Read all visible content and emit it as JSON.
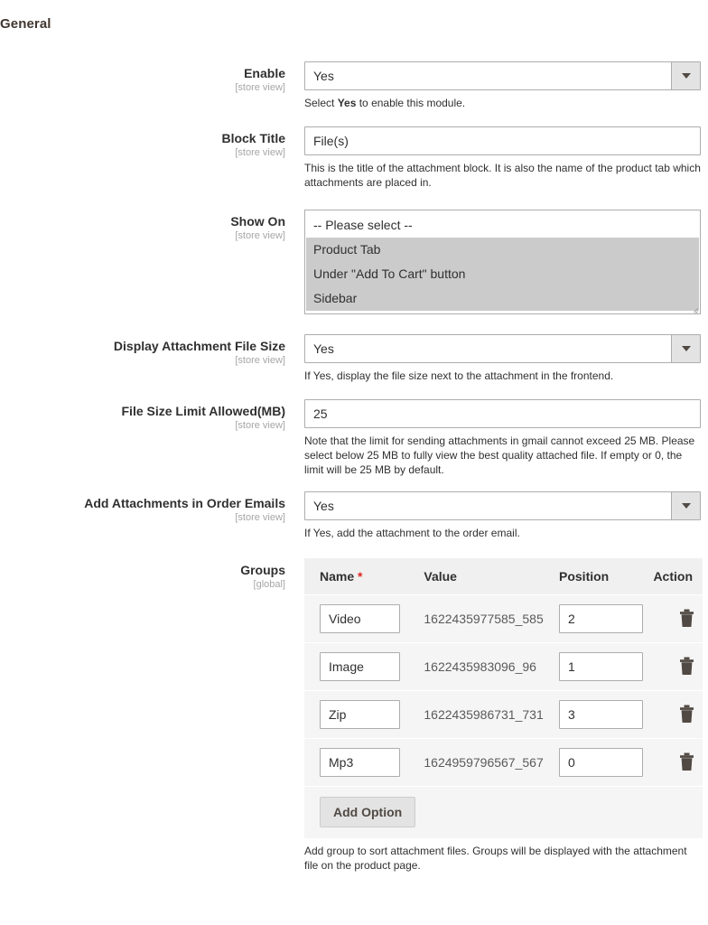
{
  "section": {
    "title": "General"
  },
  "scope_labels": {
    "store_view": "[store view]",
    "global": "[global]"
  },
  "fields": {
    "enable": {
      "label": "Enable",
      "scope": "[store view]",
      "value": "Yes",
      "note_prefix": "Select ",
      "note_bold": "Yes",
      "note_suffix": " to enable this module."
    },
    "block_title": {
      "label": "Block Title",
      "scope": "[store view]",
      "value": "File(s)",
      "note": "This is the title of the attachment block. It is also the name of the product tab which attachments are placed in."
    },
    "show_on": {
      "label": "Show On",
      "scope": "[store view]",
      "options": [
        {
          "label": "-- Please select --",
          "selected": false
        },
        {
          "label": "Product Tab",
          "selected": true
        },
        {
          "label": "Under \"Add To Cart\" button",
          "selected": true
        },
        {
          "label": "Sidebar",
          "selected": true
        }
      ]
    },
    "display_file_size": {
      "label": "Display Attachment File Size",
      "scope": "[store view]",
      "value": "Yes",
      "note": "If Yes, display the file size next to the attachment in the frontend."
    },
    "file_size_limit": {
      "label": "File Size Limit Allowed(MB)",
      "scope": "[store view]",
      "value": "25",
      "note": "Note that the limit for sending attachments in gmail cannot exceed 25 MB. Please select below 25 MB to fully view the best quality attached file. If empty or 0, the limit will be 25 MB by default."
    },
    "order_emails": {
      "label": "Add Attachments in Order Emails",
      "scope": "[store view]",
      "value": "Yes",
      "note": "If Yes, add the attachment to the order email."
    },
    "groups": {
      "label": "Groups",
      "scope": "[global]",
      "note": "Add group to sort attachment files. Groups will be displayed with the attachment file on the product page.",
      "add_option_label": "Add Option",
      "columns": {
        "name": "Name",
        "name_required_marker": "*",
        "value": "Value",
        "position": "Position",
        "action": "Action"
      },
      "rows": [
        {
          "name": "Video",
          "value": "1622435977585_585",
          "position": "2",
          "delete_icon": "trash-icon"
        },
        {
          "name": "Image",
          "value": "1622435983096_96",
          "position": "1",
          "delete_icon": "trash-icon"
        },
        {
          "name": "Zip",
          "value": "1622435986731_731",
          "position": "3",
          "delete_icon": "trash-icon"
        },
        {
          "name": "Mp3",
          "value": "1624959796567_567",
          "position": "0",
          "delete_icon": "trash-icon"
        }
      ]
    }
  },
  "colors": {
    "heading": "#41362f",
    "text": "#303030",
    "scope": "#a6a6a6",
    "required": "#e22626",
    "input_border": "#adadad",
    "row_bg": "#f5f5f5",
    "header_bg": "#f0f0f0",
    "selected_option_bg": "#cbcbcb",
    "button_bg": "#e3e3e3",
    "trash": "#514943"
  }
}
